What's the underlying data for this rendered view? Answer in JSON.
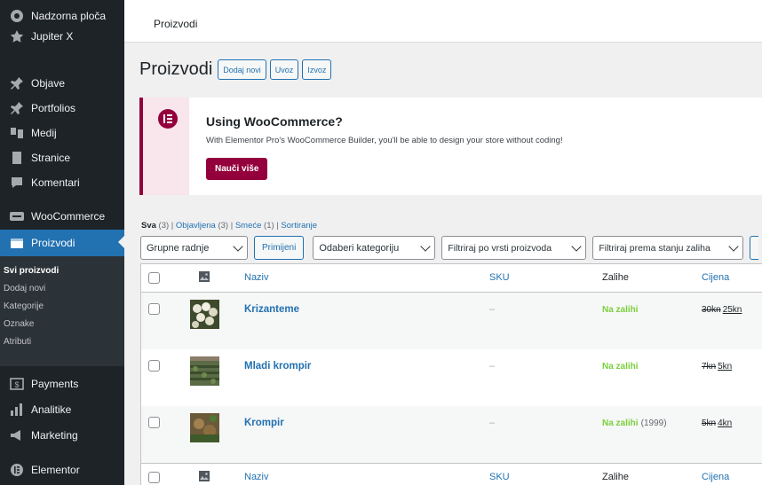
{
  "sidebar": {
    "items": [
      {
        "label": "Nadzorna ploča",
        "icon": "dashboard-icon"
      },
      {
        "label": "Jupiter X",
        "icon": "star-icon"
      },
      {
        "label": "Objave",
        "icon": "pin-icon"
      },
      {
        "label": "Portfolios",
        "icon": "pin-icon"
      },
      {
        "label": "Medij",
        "icon": "media-icon"
      },
      {
        "label": "Stranice",
        "icon": "page-icon"
      },
      {
        "label": "Komentari",
        "icon": "comment-icon"
      },
      {
        "label": "WooCommerce",
        "icon": "woo-icon"
      },
      {
        "label": "Proizvodi",
        "icon": "products-icon"
      },
      {
        "label": "Payments",
        "icon": "payments-icon"
      },
      {
        "label": "Analitike",
        "icon": "analytics-icon"
      },
      {
        "label": "Marketing",
        "icon": "marketing-icon"
      },
      {
        "label": "Elementor",
        "icon": "elementor-icon"
      }
    ],
    "submenu": [
      "Svi proizvodi",
      "Dodaj novi",
      "Kategorije",
      "Oznake",
      "Atributi"
    ]
  },
  "topbar": {
    "breadcrumb": "Proizvodi"
  },
  "heading": {
    "title": "Proizvodi",
    "add_new": "Dodaj novi",
    "import": "Uvoz",
    "export": "Izvoz"
  },
  "notice": {
    "title": "Using WooCommerce?",
    "text": "With Elementor Pro's WooCommerce Builder, you'll be able to design your store without coding!",
    "button": "Nauči više",
    "accent": "#93003c"
  },
  "views": {
    "all": "Sva",
    "all_count": "(3)",
    "published": "Objavljena",
    "published_count": "(3)",
    "trash": "Smeće",
    "trash_count": "(1)",
    "sort": "Sortiranje"
  },
  "filters": {
    "bulk": "Grupne radnje",
    "apply": "Primijeni",
    "category": "Odaberi kategoriju",
    "type": "Filtriraj po vrsti proizvoda",
    "stock": "Filtriraj prema stanju zaliha"
  },
  "table": {
    "columns": {
      "name": "Naziv",
      "sku": "SKU",
      "stock": "Zalihe",
      "price": "Cijena"
    },
    "rows": [
      {
        "name": "Krizanteme",
        "sku": "–",
        "stock": "Na zalihi",
        "stock_count": "",
        "old_price": "30kn",
        "new_price": "25kn"
      },
      {
        "name": "Mladi krompir",
        "sku": "–",
        "stock": "Na zalihi",
        "stock_count": "",
        "old_price": "7kn",
        "new_price": "5kn"
      },
      {
        "name": "Krompir",
        "sku": "–",
        "stock": "Na zalihi",
        "stock_count": "(1999)",
        "old_price": "5kn",
        "new_price": "4kn"
      }
    ]
  }
}
